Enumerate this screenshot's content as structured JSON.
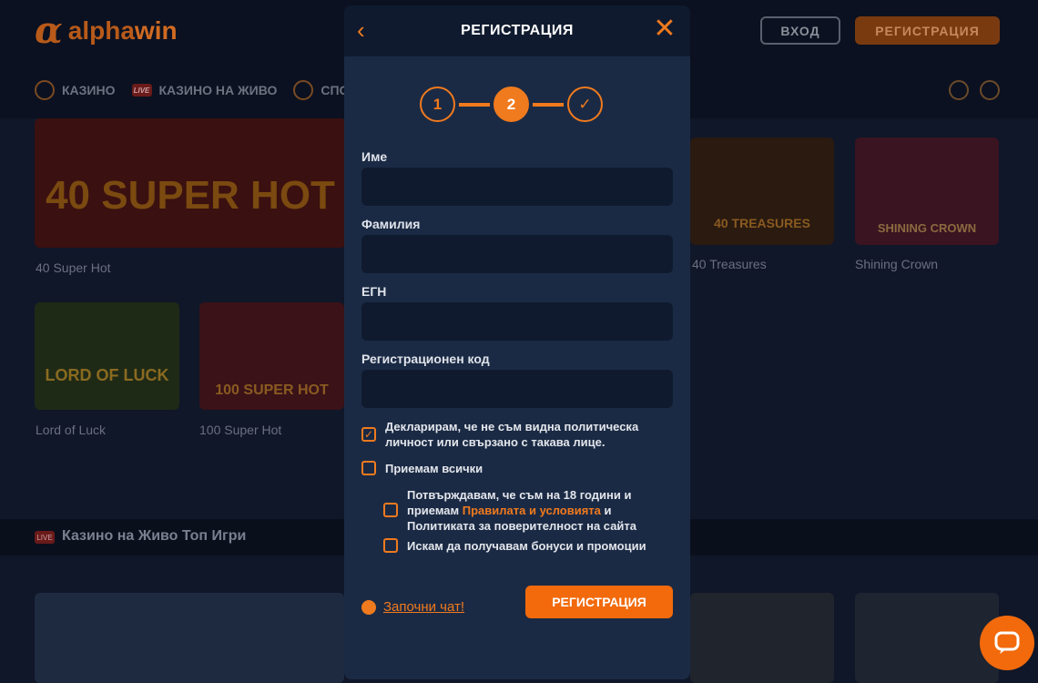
{
  "header": {
    "logo_text_1": "alpha",
    "logo_text_2": "win",
    "login": "ВХОД",
    "register": "РЕГИСТРАЦИЯ"
  },
  "nav": [
    "КАЗИНО",
    "КАЗИНО НА ЖИВО",
    "СПОРТ"
  ],
  "live_badge": "LIVE",
  "games": [
    {
      "title": "40 SUPER HOT",
      "label": "40 Super Hot"
    },
    {
      "title": "40 TREASURES",
      "label": "40 Treasures"
    },
    {
      "title": "SHINING CROWN",
      "label": "Shining Crown"
    },
    {
      "title": "LORD OF LUCK",
      "label": "Lord of Luck"
    },
    {
      "title": "100 SUPER HOT",
      "label": "100 Super Hot"
    }
  ],
  "section_title": "Казино на Живо Топ Игри",
  "modal": {
    "title": "РЕГИСТРАЦИЯ",
    "steps": [
      "1",
      "2",
      "✓"
    ],
    "fields": [
      {
        "label": "Име",
        "value": ""
      },
      {
        "label": "Фамилия",
        "value": ""
      },
      {
        "label": "ЕГН",
        "value": ""
      },
      {
        "label": "Регистрационен код",
        "value": ""
      }
    ],
    "checkbox_declare": "Декларирам, че не съм видна политическа личност или свързано с такава лице.",
    "checkbox_accept_all": "Приемам всички",
    "checkbox_terms_pre": "Потвърждавам, че съм на 18 години и приемам",
    "checkbox_terms_link": "Правилата и условията",
    "checkbox_terms_post": "и Политиката за поверителност на сайта",
    "checkbox_bonus": "Искам да получавам бонуси и промоции",
    "chat_link": "Започни чат!",
    "submit": "РЕГИСТРАЦИЯ"
  }
}
